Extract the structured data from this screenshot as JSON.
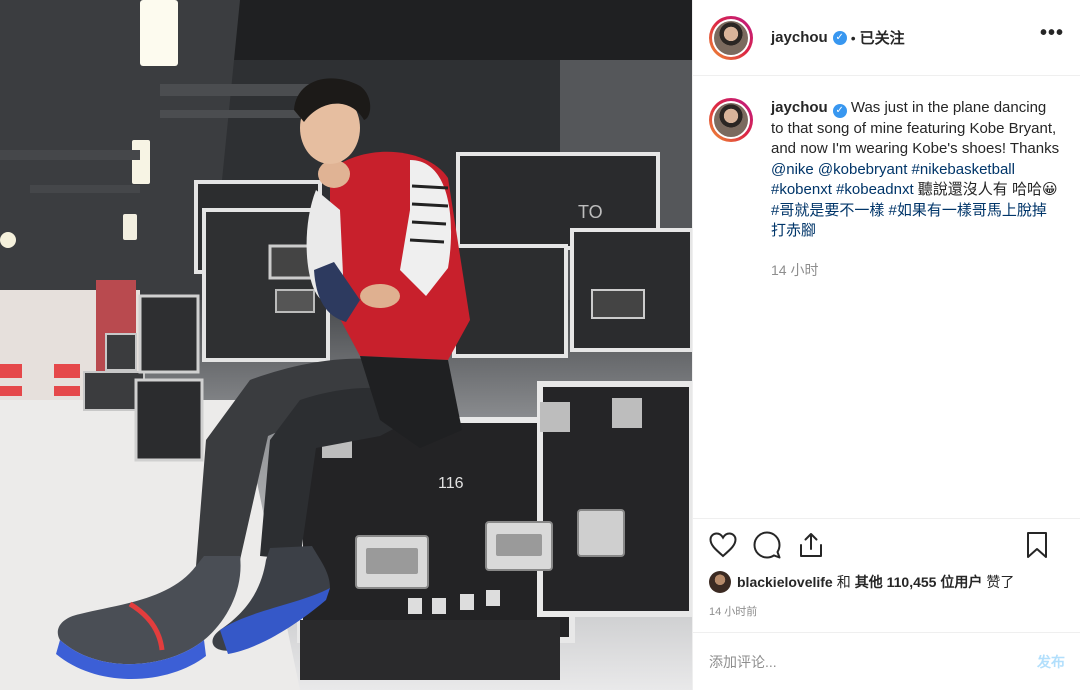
{
  "post": {
    "username": "jaychou",
    "verified_glyph": "✓",
    "separator": "•",
    "follow_status": "已关注",
    "more_glyph": "•••"
  },
  "caption": {
    "username": "jaychou",
    "text_1": "Was just in the plane dancing to that song of mine featuring Kobe Bryant, and now I'm wearing Kobe's shoes! Thanks ",
    "mention_1": "@nike",
    "mention_2": "@kobebryant",
    "tag_1": "#nikebasketball",
    "tag_2": "#kobenxt",
    "tag_3": "#kobeadnxt",
    "text_2": " 聽說還沒人有 哈哈😀 ",
    "tag_4": "#哥就是要不一樣",
    "tag_5": "#如果有一樣哥馬上脫掉打赤腳",
    "time_ago": "14 小时"
  },
  "likes": {
    "liker": "blackielovelife",
    "connector": "和",
    "count_text": "其他 110,455 位用户",
    "suffix": "赞了"
  },
  "posted_time": "14 小时前",
  "comment": {
    "placeholder": "添加评论...",
    "post_label": "发布"
  },
  "photo": {
    "case_number": "116",
    "case_logo": "TO"
  },
  "icons": [
    "heart-icon",
    "comment-icon",
    "share-icon",
    "bookmark-icon",
    "verified-icon",
    "more-icon"
  ],
  "colors": {
    "link": "#003569",
    "verified": "#3897f0",
    "muted": "#8e8e8e",
    "post_disabled": "#b2dffc",
    "jacket_red": "#c8202c"
  }
}
